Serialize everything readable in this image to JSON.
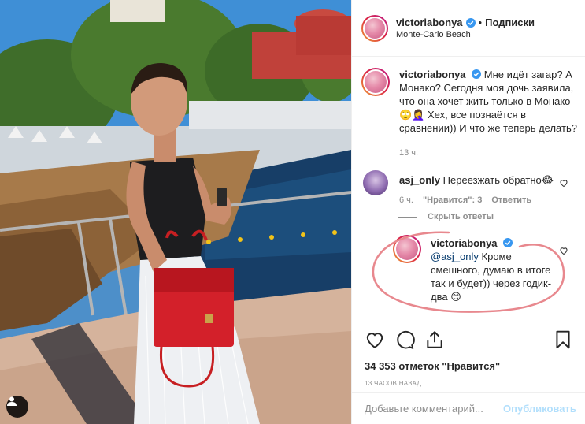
{
  "post": {
    "author": "victoriabonya",
    "follow_label": "Подписки",
    "location": "Monte-Carlo Beach",
    "caption_author": "victoriabonya",
    "caption_text": "Мне идёт загар? А Монако? Сегодня моя дочь заявила, что она хочет жить только в Монако 🙄🤦‍♀️ Хех, все познаётся в сравнении)) И что же теперь делать?",
    "caption_time": "13 ч."
  },
  "comments": [
    {
      "author": "asj_only",
      "text": "Переезжать обратно😂",
      "time": "6 ч.",
      "likes": "\"Нравится\": 3",
      "reply_label": "Ответить"
    }
  ],
  "hide_replies_label": "Скрыть ответы",
  "reply": {
    "author": "victoriabonya",
    "mention": "@asj_only",
    "text": " Кроме смешного, думаю в итоге так и будет)) через годик-два 😊"
  },
  "actions": {
    "likes_text": "34 353 отметок \"Нравится\"",
    "time_ago": "13 ЧАСОВ НАЗАД"
  },
  "add_comment": {
    "placeholder": "Добавьте комментарий...",
    "publish_label": "Опубликовать"
  },
  "colors": {
    "annotation": "#e8888e",
    "verified": "#3897f0",
    "link": "#00376b",
    "publish_disabled": "#b2dffc"
  }
}
